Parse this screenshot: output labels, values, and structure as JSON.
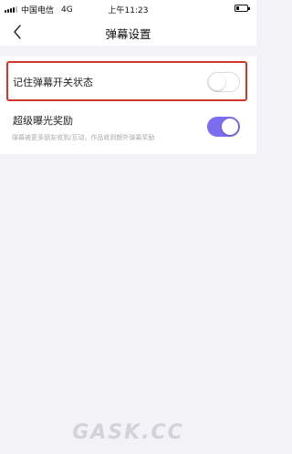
{
  "status_bar": {
    "carrier": "中国电信",
    "network": "4G",
    "time": "上午11:23"
  },
  "nav": {
    "title": "弹幕设置",
    "back_icon": "chevron-left-icon"
  },
  "settings": {
    "remember_danmaku": {
      "label": "记住弹幕开关状态",
      "enabled": false
    },
    "super_exposure": {
      "label": "超级曝光奖励",
      "description": "弹幕被更多朋友收到/互动，作品收到额外弹幕奖励",
      "enabled": true
    }
  },
  "colors": {
    "toggle_on": "#7b6cf0",
    "highlight": "#d4332b",
    "page_bg": "#f3f3f7"
  },
  "watermark": "GASK.CC"
}
